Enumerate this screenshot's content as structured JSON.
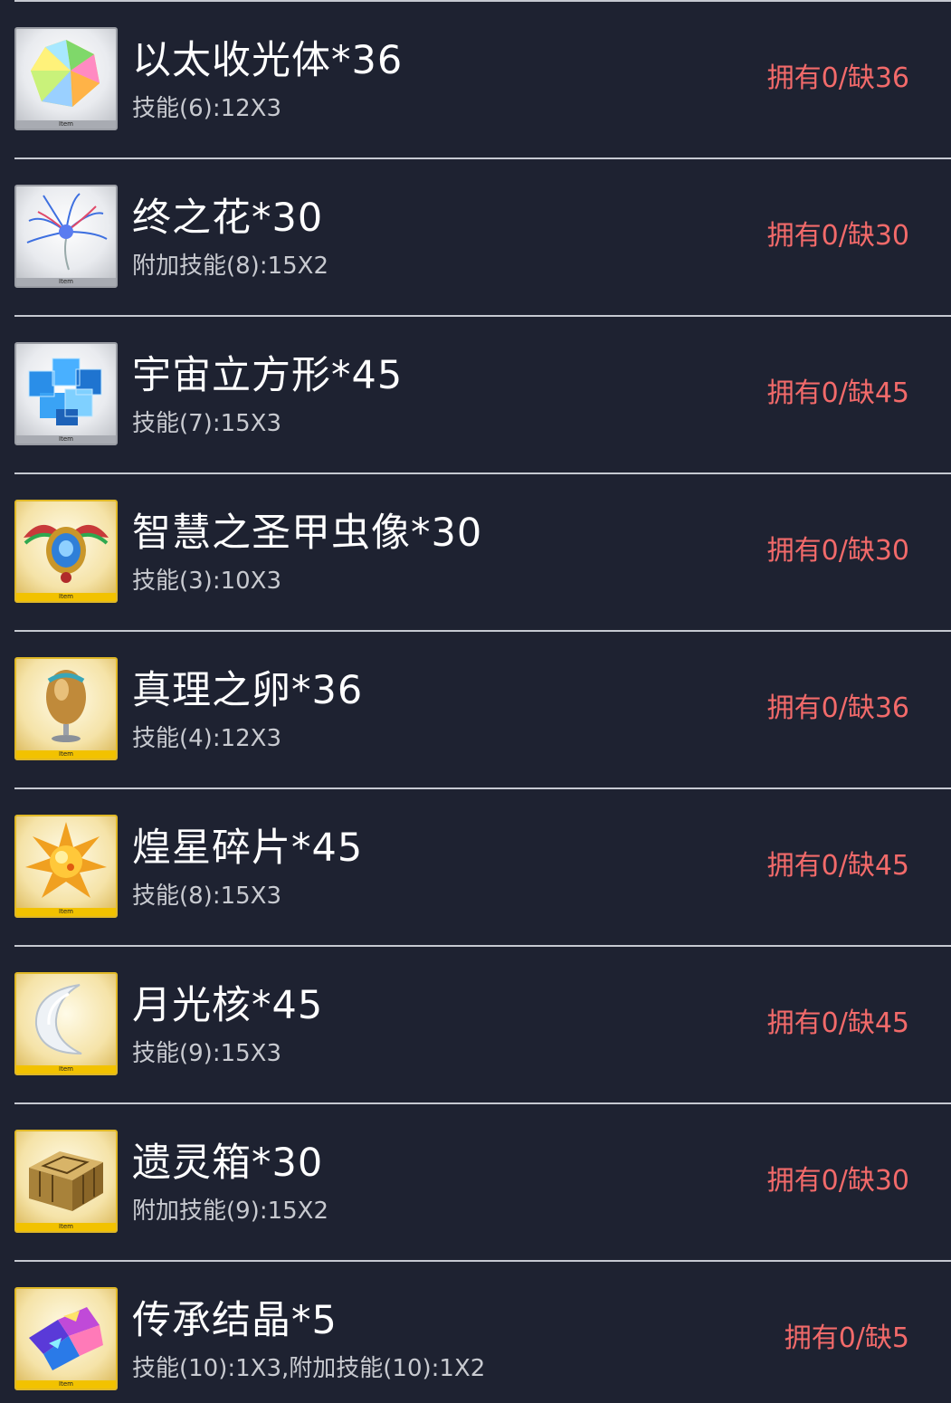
{
  "items": [
    {
      "name": "以太收光体*36",
      "skill": "技能(6):12X3",
      "status": "拥有0/缺36",
      "icon": "multicolor-crystal-icon",
      "frame": "silver",
      "tag": "Item"
    },
    {
      "name": "终之花*30",
      "skill": "附加技能(8):15X2",
      "status": "拥有0/缺30",
      "icon": "blue-spider-lily-icon",
      "frame": "silver",
      "tag": "Item"
    },
    {
      "name": "宇宙立方形*45",
      "skill": "技能(7):15X3",
      "status": "拥有0/缺45",
      "icon": "blue-cube-cluster-icon",
      "frame": "silver",
      "tag": "Item"
    },
    {
      "name": "智慧之圣甲虫像*30",
      "skill": "技能(3):10X3",
      "status": "拥有0/缺30",
      "icon": "scarab-icon",
      "frame": "gold",
      "tag": "Item"
    },
    {
      "name": "真理之卵*36",
      "skill": "技能(4):12X3",
      "status": "拥有0/缺36",
      "icon": "golden-egg-icon",
      "frame": "gold",
      "tag": "Item"
    },
    {
      "name": "煌星碎片*45",
      "skill": "技能(8):15X3",
      "status": "拥有0/缺45",
      "icon": "golden-star-icon",
      "frame": "gold",
      "tag": "Item"
    },
    {
      "name": "月光核*45",
      "skill": "技能(9):15X3",
      "status": "拥有0/缺45",
      "icon": "crescent-moon-icon",
      "frame": "gold",
      "tag": "Item"
    },
    {
      "name": "遗灵箱*30",
      "skill": "附加技能(9):15X2",
      "status": "拥有0/缺30",
      "icon": "golden-chest-icon",
      "frame": "gold",
      "tag": "Item"
    },
    {
      "name": "传承结晶*5",
      "skill": "技能(10):1X3,附加技能(10):1X2",
      "status": "拥有0/缺5",
      "icon": "crystal-shard-icon",
      "frame": "gold",
      "tag": "Item"
    }
  ],
  "colors": {
    "background": "#1e2231",
    "divider": "#c6c9d1",
    "name": "#ffffff",
    "skill": "#c8cad0",
    "status": "#f26a6a"
  }
}
